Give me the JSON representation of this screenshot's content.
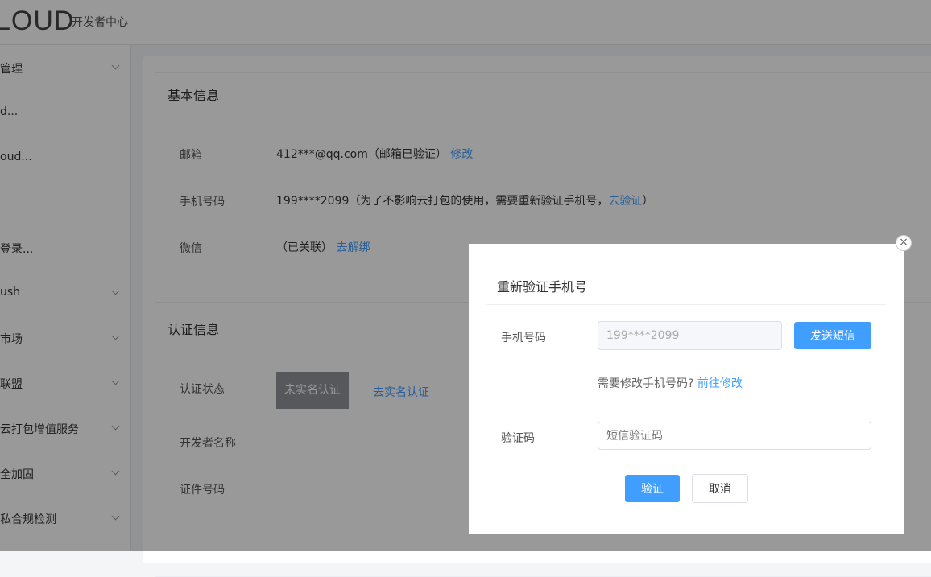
{
  "header": {
    "logo": "LOUD",
    "subtitle": "开发者中心"
  },
  "sidebar": {
    "items": [
      {
        "label": "管理",
        "has_chevron": true
      },
      {
        "label": "d...",
        "has_chevron": false
      },
      {
        "label": "oud...",
        "has_chevron": false
      },
      {
        "label": "",
        "has_chevron": false
      },
      {
        "label": "登录...",
        "has_chevron": false
      },
      {
        "label": "ush",
        "has_chevron": true
      },
      {
        "label": "市场",
        "has_chevron": true
      },
      {
        "label": "联盟",
        "has_chevron": true
      },
      {
        "label": "云打包增值服务",
        "has_chevron": true
      },
      {
        "label": "全加固",
        "has_chevron": true
      },
      {
        "label": "私合规检测",
        "has_chevron": true
      }
    ]
  },
  "basic_info": {
    "title": "基本信息",
    "email_label": "邮箱",
    "email_value": "412***@qq.com（邮箱已验证）",
    "email_action": "修改",
    "phone_label": "手机号码",
    "phone_value": "199****2099（为了不影响云打包的使用，需要重新验证手机号，",
    "phone_action": "去验证",
    "phone_suffix": "）",
    "wechat_label": "微信",
    "wechat_value": "（已关联）",
    "wechat_action": "去解绑"
  },
  "auth_info": {
    "title": "认证信息",
    "status_label": "认证状态",
    "status_badge": "未实名认证",
    "status_action": "去实名认证",
    "dev_name_label": "开发者名称",
    "id_label": "证件号码"
  },
  "dialog": {
    "title": "重新验证手机号",
    "phone_label": "手机号码",
    "phone_value": "199****2099",
    "send_sms": "发送短信",
    "hint": "需要修改手机号码?",
    "hint_link": "前往修改",
    "code_label": "验证码",
    "code_placeholder": "短信验证码",
    "verify_button": "验证",
    "cancel_button": "取消",
    "close_icon": "×"
  }
}
